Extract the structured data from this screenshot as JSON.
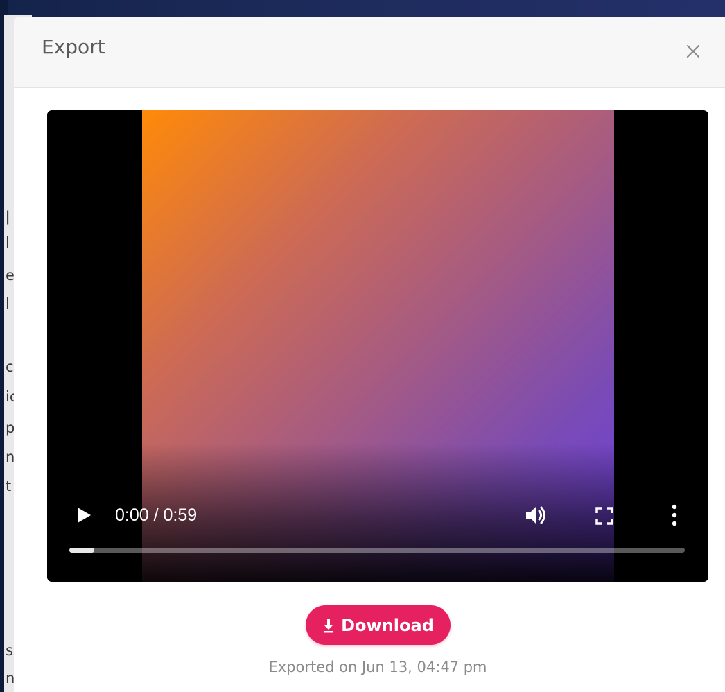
{
  "background_page": {
    "text_fragments": [
      "ǀ",
      "l",
      "e",
      "l",
      "c",
      "ic",
      "p",
      "nj",
      "t",
      "s",
      "n:"
    ]
  },
  "modal": {
    "title": "Export",
    "close_icon": "close-icon"
  },
  "video": {
    "current_time": "0:00",
    "duration": "0:59",
    "time_display": "0:00 / 0:59",
    "progress_fraction": 0.04,
    "gradient_colors": [
      "#ff8a08",
      "#a35a85",
      "#6a3ee2"
    ],
    "icons": {
      "play": "play-icon",
      "volume": "volume-icon",
      "fullscreen": "fullscreen-icon",
      "more": "more-vertical-icon"
    }
  },
  "download": {
    "label": "Download",
    "icon": "download-icon",
    "color": "#e6215f"
  },
  "status": {
    "exported_text": "Exported on Jun 13, 04:47 pm"
  }
}
